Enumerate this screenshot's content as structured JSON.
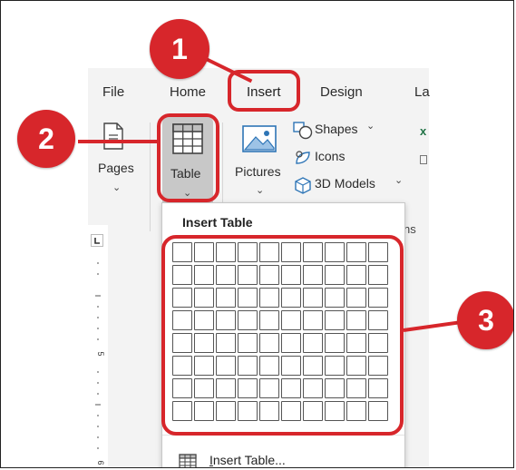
{
  "ribbon": {
    "tabs": [
      "File",
      "Home",
      "Insert",
      "Design",
      "La"
    ],
    "active_tab": "Insert",
    "pages_label": "Pages",
    "table_label": "Table",
    "pictures_label": "Pictures",
    "shapes_label": "Shapes",
    "icons_label": "Icons",
    "models_label": "3D Models",
    "partial_group_label": "ns"
  },
  "dropdown": {
    "title": "Insert Table",
    "grid_columns": 10,
    "grid_rows": 8,
    "insert_table_accel": "I",
    "insert_table_rest": "nsert Table..."
  },
  "annotations": {
    "step1": "1",
    "step2": "2",
    "step3": "3",
    "color": "#d7262b"
  },
  "colors": {
    "ribbon_bg": "#f3f3f3",
    "tab_underline": "#2b579a",
    "icon_blue": "#2e75b6"
  }
}
